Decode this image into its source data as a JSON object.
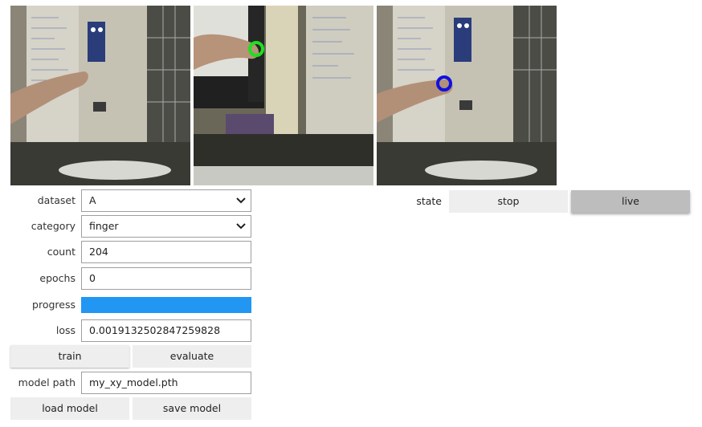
{
  "colors": {
    "accent": "#2196f3",
    "button_bg": "#eeeeee",
    "button_active_bg": "#bdbdbd",
    "marker_green": "#1ee01e",
    "marker_blue": "#1010e0"
  },
  "camera_views": [
    {
      "name": "live-camera-image",
      "marker": null
    },
    {
      "name": "snapshot-image",
      "marker": "green-circle"
    },
    {
      "name": "prediction-image",
      "marker": "blue-circle"
    }
  ],
  "form": {
    "dataset": {
      "label": "dataset",
      "value": "A"
    },
    "category": {
      "label": "category",
      "value": "finger"
    },
    "count": {
      "label": "count",
      "value": "204"
    },
    "epochs": {
      "label": "epochs",
      "value": "0"
    },
    "progress": {
      "label": "progress",
      "value": 1.0
    },
    "loss": {
      "label": "loss",
      "value": "0.0019132502847259828"
    },
    "train_button": "train",
    "evaluate_button": "evaluate",
    "model_path": {
      "label": "model path",
      "value": "my_xy_model.pth"
    },
    "load_button": "load model",
    "save_button": "save model"
  },
  "state": {
    "label": "state",
    "options": [
      "stop",
      "live"
    ],
    "selected": "live"
  }
}
